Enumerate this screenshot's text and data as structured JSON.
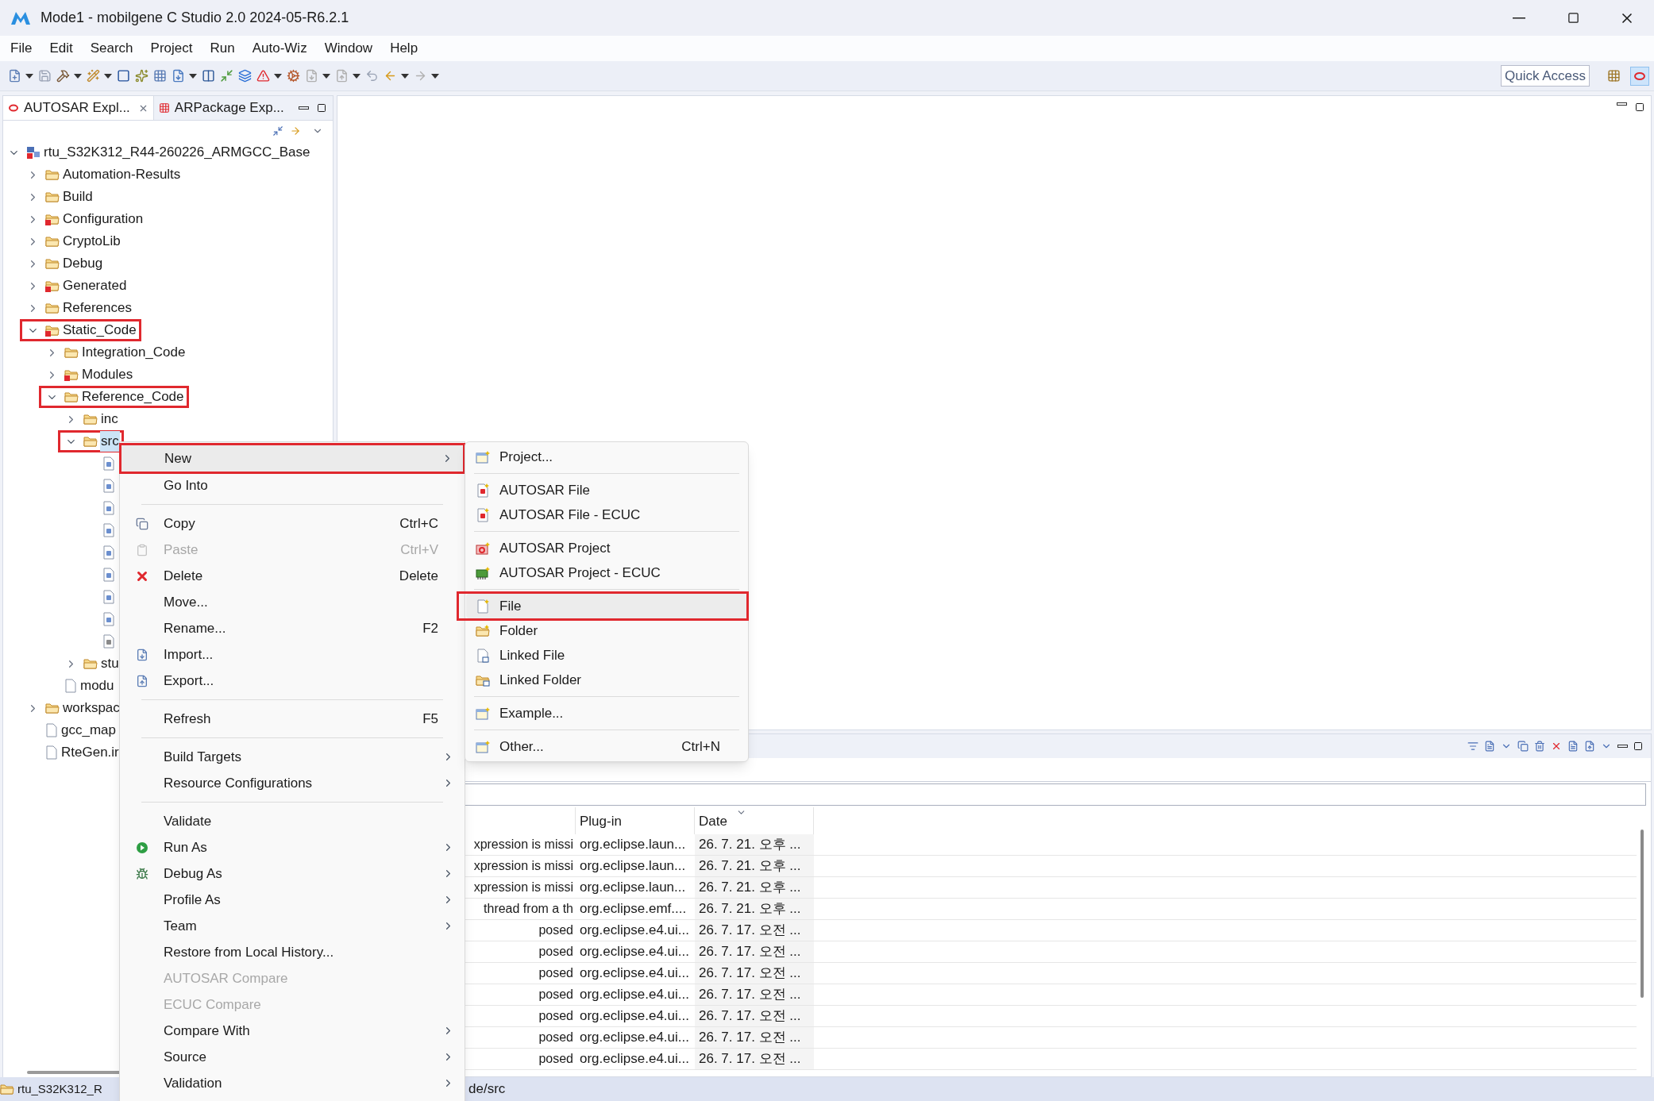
{
  "window": {
    "title": "Mode1 - mobilgene C Studio 2.0 2024-05-R6.2.1"
  },
  "menu_bar": [
    "File",
    "Edit",
    "Search",
    "Project",
    "Run",
    "Auto-Wiz",
    "Window",
    "Help"
  ],
  "quick_access": {
    "placeholder": "Quick Access"
  },
  "explorer": {
    "tabs": [
      {
        "label": "AUTOSAR Expl...",
        "selected": true
      },
      {
        "label": "ARPackage Exp...",
        "selected": false
      }
    ],
    "tree": [
      {
        "label": "rtu_S32K312_R44-260226_ARMGCC_Base",
        "kind": "project",
        "expanded": true,
        "annotated": false,
        "selected": false,
        "children": [
          {
            "label": "Automation-Results",
            "kind": "folder",
            "expanded": false,
            "badge": false,
            "annotated": false,
            "selected": false
          },
          {
            "label": "Build",
            "kind": "folder",
            "expanded": false,
            "badge": false,
            "annotated": false,
            "selected": false
          },
          {
            "label": "Configuration",
            "kind": "folder",
            "expanded": false,
            "badge": true,
            "annotated": false,
            "selected": false
          },
          {
            "label": "CryptoLib",
            "kind": "folder",
            "expanded": false,
            "badge": false,
            "annotated": false,
            "selected": false
          },
          {
            "label": "Debug",
            "kind": "folder",
            "expanded": false,
            "badge": false,
            "annotated": false,
            "selected": false
          },
          {
            "label": "Generated",
            "kind": "folder",
            "expanded": false,
            "badge": true,
            "annotated": false,
            "selected": false
          },
          {
            "label": "References",
            "kind": "folder",
            "expanded": false,
            "badge": false,
            "annotated": false,
            "selected": false
          },
          {
            "label": "Static_Code",
            "kind": "folder",
            "expanded": true,
            "badge": true,
            "annotated": true,
            "selected": false,
            "children": [
              {
                "label": "Integration_Code",
                "kind": "folder",
                "expanded": false,
                "badge": false,
                "annotated": false,
                "selected": false
              },
              {
                "label": "Modules",
                "kind": "folder",
                "expanded": false,
                "badge": true,
                "annotated": false,
                "selected": false
              },
              {
                "label": "Reference_Code",
                "kind": "folder",
                "expanded": true,
                "badge": false,
                "annotated": true,
                "selected": false,
                "children": [
                  {
                    "label": "inc",
                    "kind": "folder",
                    "expanded": false,
                    "badge": false,
                    "annotated": false,
                    "selected": false
                  },
                  {
                    "label": "src",
                    "kind": "folder",
                    "expanded": true,
                    "badge": false,
                    "annotated": true,
                    "selected": true,
                    "children": [
                      {
                        "kind": "c-file",
                        "annotated": false,
                        "selected": false
                      },
                      {
                        "kind": "c-file",
                        "annotated": false,
                        "selected": false
                      },
                      {
                        "kind": "c-file",
                        "annotated": false,
                        "selected": false
                      },
                      {
                        "kind": "c-file",
                        "annotated": false,
                        "selected": false
                      },
                      {
                        "kind": "c-file",
                        "annotated": false,
                        "selected": false
                      },
                      {
                        "kind": "c-file",
                        "annotated": false,
                        "selected": false
                      },
                      {
                        "kind": "c-file",
                        "annotated": false,
                        "selected": false
                      },
                      {
                        "kind": "c-file",
                        "annotated": false,
                        "selected": false
                      },
                      {
                        "kind": "asm-file",
                        "annotated": false,
                        "selected": false
                      }
                    ]
                  },
                  {
                    "label": "stu",
                    "kind": "folder",
                    "expanded": false,
                    "badge": false,
                    "annotated": false,
                    "selected": false
                  }
                ]
              },
              {
                "label": "modu",
                "kind": "file",
                "annotated": false,
                "selected": false
              }
            ]
          },
          {
            "label": "workspac",
            "kind": "folder",
            "expanded": false,
            "badge": false,
            "annotated": false,
            "selected": false
          },
          {
            "label": "gcc_map",
            "kind": "file",
            "annotated": false,
            "selected": false
          },
          {
            "label": "RteGen.ir",
            "kind": "file",
            "annotated": false,
            "selected": false
          }
        ]
      }
    ]
  },
  "context_menu": {
    "items": [
      {
        "kind": "plain",
        "label": "New",
        "submenu": true,
        "disabled": false,
        "hovered": true,
        "annotated": true
      },
      {
        "kind": "plain",
        "label": "Go Into",
        "submenu": false,
        "disabled": false,
        "hovered": false,
        "annotated": false
      },
      {
        "kind": "separator"
      },
      {
        "kind": "copy",
        "label": "Copy",
        "shortcut": "Ctrl+C",
        "submenu": false,
        "disabled": false,
        "hovered": false,
        "annotated": false
      },
      {
        "kind": "paste",
        "label": "Paste",
        "shortcut": "Ctrl+V",
        "submenu": false,
        "disabled": true,
        "hovered": false,
        "annotated": false
      },
      {
        "kind": "delete",
        "label": "Delete",
        "shortcut": "Delete",
        "submenu": false,
        "disabled": false,
        "hovered": false,
        "annotated": false
      },
      {
        "kind": "plain",
        "label": "Move...",
        "submenu": false,
        "disabled": false,
        "hovered": false,
        "annotated": false
      },
      {
        "kind": "plain",
        "label": "Rename...",
        "shortcut": "F2",
        "submenu": false,
        "disabled": false,
        "hovered": false,
        "annotated": false
      },
      {
        "kind": "import",
        "label": "Import...",
        "submenu": false,
        "disabled": false,
        "hovered": false,
        "annotated": false
      },
      {
        "kind": "export",
        "label": "Export...",
        "submenu": false,
        "disabled": false,
        "hovered": false,
        "annotated": false
      },
      {
        "kind": "separator"
      },
      {
        "kind": "plain",
        "label": "Refresh",
        "shortcut": "F5",
        "submenu": false,
        "disabled": false,
        "hovered": false,
        "annotated": false
      },
      {
        "kind": "separator"
      },
      {
        "kind": "plain",
        "label": "Build Targets",
        "submenu": true,
        "disabled": false,
        "hovered": false,
        "annotated": false
      },
      {
        "kind": "plain",
        "label": "Resource Configurations",
        "submenu": true,
        "disabled": false,
        "hovered": false,
        "annotated": false
      },
      {
        "kind": "separator"
      },
      {
        "kind": "plain",
        "label": "Validate",
        "submenu": false,
        "disabled": false,
        "hovered": false,
        "annotated": false
      },
      {
        "kind": "run",
        "label": "Run As",
        "submenu": true,
        "disabled": false,
        "hovered": false,
        "annotated": false
      },
      {
        "kind": "debug",
        "label": "Debug As",
        "submenu": true,
        "disabled": false,
        "hovered": false,
        "annotated": false
      },
      {
        "kind": "plain",
        "label": "Profile As",
        "submenu": true,
        "disabled": false,
        "hovered": false,
        "annotated": false
      },
      {
        "kind": "plain",
        "label": "Team",
        "submenu": true,
        "disabled": false,
        "hovered": false,
        "annotated": false
      },
      {
        "kind": "plain",
        "label": "Restore from Local History...",
        "submenu": false,
        "disabled": false,
        "hovered": false,
        "annotated": false
      },
      {
        "kind": "plain",
        "label": "AUTOSAR Compare",
        "submenu": false,
        "disabled": true,
        "hovered": false,
        "annotated": false
      },
      {
        "kind": "plain",
        "label": "ECUC Compare",
        "submenu": false,
        "disabled": true,
        "hovered": false,
        "annotated": false
      },
      {
        "kind": "plain",
        "label": "Compare With",
        "submenu": true,
        "disabled": false,
        "hovered": false,
        "annotated": false
      },
      {
        "kind": "plain",
        "label": "Source",
        "submenu": true,
        "disabled": false,
        "hovered": false,
        "annotated": false
      },
      {
        "kind": "plain",
        "label": "Validation",
        "submenu": true,
        "disabled": false,
        "hovered": false,
        "annotated": false
      }
    ]
  },
  "new_submenu": {
    "items": [
      {
        "kind": "wizard",
        "label": "Project...",
        "hovered": false,
        "annotated": false
      },
      {
        "kind": "separator"
      },
      {
        "kind": "autosar-file",
        "label": "AUTOSAR File",
        "hovered": false,
        "annotated": false
      },
      {
        "kind": "autosar-file",
        "label": "AUTOSAR File - ECUC",
        "hovered": false,
        "annotated": false
      },
      {
        "kind": "separator"
      },
      {
        "kind": "autosar-project",
        "label": "AUTOSAR Project",
        "hovered": false,
        "annotated": false
      },
      {
        "kind": "ecuc-project",
        "label": "AUTOSAR Project - ECUC",
        "hovered": false,
        "annotated": false
      },
      {
        "kind": "separator"
      },
      {
        "kind": "file",
        "label": "File",
        "hovered": true,
        "annotated": true
      },
      {
        "kind": "folder",
        "label": "Folder",
        "hovered": false,
        "annotated": false
      },
      {
        "kind": "linked-file",
        "label": "Linked File",
        "hovered": false,
        "annotated": false
      },
      {
        "kind": "linked-folder",
        "label": "Linked Folder",
        "hovered": false,
        "annotated": false
      },
      {
        "kind": "separator"
      },
      {
        "kind": "wizard",
        "label": "Example...",
        "hovered": false,
        "annotated": false
      },
      {
        "kind": "separator"
      },
      {
        "kind": "wizard",
        "label": "Other...",
        "shortcut": "Ctrl+N",
        "hovered": false,
        "annotated": false
      }
    ]
  },
  "error_log": {
    "columns": [
      "Plug-in",
      "Date"
    ],
    "rows": [
      {
        "message": "xpression is missi",
        "plugin": "org.eclipse.laun...",
        "date": "26. 7. 21. 오후 ..."
      },
      {
        "message": "xpression is missi",
        "plugin": "org.eclipse.laun...",
        "date": "26. 7. 21. 오후 ..."
      },
      {
        "message": "xpression is missi",
        "plugin": "org.eclipse.laun...",
        "date": "26. 7. 21. 오후 ..."
      },
      {
        "message": "thread from a th",
        "plugin": "org.eclipse.emf....",
        "date": "26. 7. 21. 오후 ..."
      },
      {
        "message": "posed",
        "plugin": "org.eclipse.e4.ui...",
        "date": "26. 7. 17. 오전 ..."
      },
      {
        "message": "posed",
        "plugin": "org.eclipse.e4.ui...",
        "date": "26. 7. 17. 오전 ..."
      },
      {
        "message": "posed",
        "plugin": "org.eclipse.e4.ui...",
        "date": "26. 7. 17. 오전 ..."
      },
      {
        "message": "posed",
        "plugin": "org.eclipse.e4.ui...",
        "date": "26. 7. 17. 오전 ..."
      },
      {
        "message": "posed",
        "plugin": "org.eclipse.e4.ui...",
        "date": "26. 7. 17. 오전 ..."
      },
      {
        "message": "posed",
        "plugin": "org.eclipse.e4.ui...",
        "date": "26. 7. 17. 오전 ..."
      },
      {
        "message": "posed",
        "plugin": "org.eclipse.e4.ui...",
        "date": "26. 7. 17. 오전 ..."
      }
    ]
  },
  "status_bar": {
    "resource": "rtu_S32K312_R",
    "path": "de/src"
  }
}
